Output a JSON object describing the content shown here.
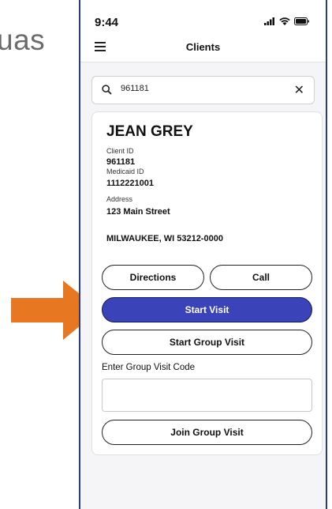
{
  "background_text": "uas",
  "colors": {
    "accent": "#3a43b7",
    "arrow": "#e87722",
    "frame": "#2c3d7a"
  },
  "status_bar": {
    "time": "9:44",
    "icons": [
      "signal-icon",
      "wifi-icon",
      "battery-icon"
    ]
  },
  "nav": {
    "title": "Clients",
    "menu_icon": "hamburger-menu-icon"
  },
  "search": {
    "value": "961181",
    "icon": "search-icon",
    "clear_icon": "close-icon"
  },
  "client": {
    "name": "JEAN GREY",
    "client_id_label": "Client ID",
    "client_id": "961181",
    "medicaid_id_label": "Medicaid ID",
    "medicaid_id": "1112221001",
    "address_label": "Address",
    "address_line1": "123 Main Street",
    "address_line2": "MILWAUKEE, WI 53212-0000"
  },
  "buttons": {
    "directions": "Directions",
    "call": "Call",
    "start_visit": "Start Visit",
    "start_group_visit": "Start Group Visit",
    "join_group_visit": "Join Group Visit"
  },
  "group_code": {
    "label": "Enter Group Visit Code",
    "value": ""
  }
}
